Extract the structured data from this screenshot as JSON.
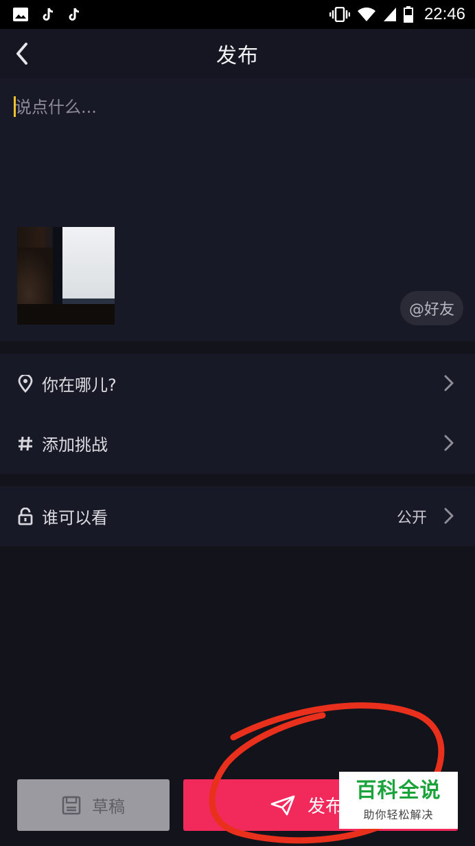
{
  "status_bar": {
    "time": "22:46",
    "left_icons": [
      "image-icon",
      "tiktok-icon",
      "tiktok-icon"
    ],
    "right_icons": [
      "vibrate-icon",
      "wifi-icon",
      "signal-icon",
      "battery-icon"
    ]
  },
  "nav": {
    "title": "发布",
    "back_icon": "chevron-left-icon"
  },
  "compose": {
    "placeholder": "说点什么...",
    "value": "",
    "cursor_color": "#f2c12e",
    "mention_label": "@好友"
  },
  "options": {
    "location": {
      "label": "你在哪儿?",
      "icon": "location-pin-icon"
    },
    "challenge": {
      "label": "添加挑战",
      "icon": "hashtag-icon"
    },
    "visibility": {
      "label": "谁可以看",
      "value": "公开",
      "icon": "lock-open-icon"
    }
  },
  "buttons": {
    "draft": {
      "label": "草稿",
      "icon": "save-icon"
    },
    "publish": {
      "label": "发布",
      "icon": "send-icon"
    }
  },
  "watermark": {
    "title": "百科全说",
    "subtitle": "助你轻松解决"
  },
  "colors": {
    "background": "#13131c",
    "panel": "#181926",
    "accent": "#f2295b",
    "draft_button": "#9b9aa0",
    "annotation": "#e8301c",
    "watermark_green": "#1aa33a"
  }
}
